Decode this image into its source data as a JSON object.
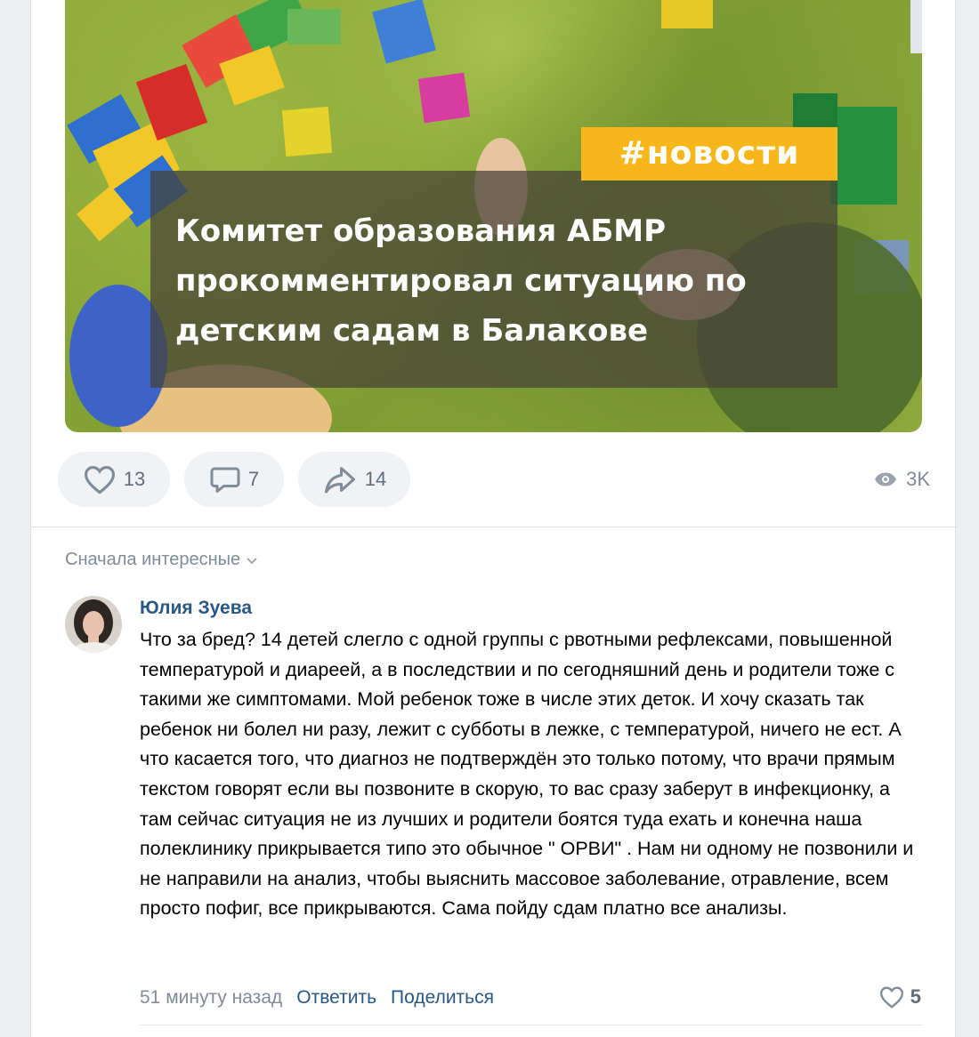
{
  "post": {
    "hashtag": "#новости",
    "headline": "Комитет образования АБМР прокомментировал ситуацию по детским садам в Балакове",
    "actions": {
      "likes": "13",
      "comments": "7",
      "shares": "14",
      "views": "3K"
    }
  },
  "comments": {
    "sort_label": "Сначала интересные",
    "items": [
      {
        "author": "Юлия Зуева",
        "text": "Что за бред? 14 детей слегло с одной группы с рвотными рефлексами, повышенной температурой и диареей, а в последствии и по сегодняшний день и родители тоже с такими же симптомами. Мой ребенок тоже в числе этих деток. И хочу сказать так ребенок ни болел ни разу, лежит с субботы в лежке, с температурой, ничего не ест. А что касается того, что диагноз не подтверждён это только потому, что врачи прямым текстом говорят если вы позвоните в скорую, то вас сразу заберут в инфекционку, а там сейчас ситуация не из лучших и родители боятся туда ехать и конечна наша полеклинику прикрывается типо это обычное \" ОРВИ\" . Нам ни одному не позвонили и не направили на анализ, чтобы выяснить массовое заболевание, отравление, всем просто пофиг, все прикрываются. Сама пойду сдам платно все анализы.",
        "time": "51 минуту назад",
        "reply_label": "Ответить",
        "share_label": "Поделиться",
        "likes": "5"
      }
    ]
  },
  "colors": {
    "link": "#2a5885",
    "muted": "#818c99",
    "hashtag_bg": "#f7b61a"
  }
}
